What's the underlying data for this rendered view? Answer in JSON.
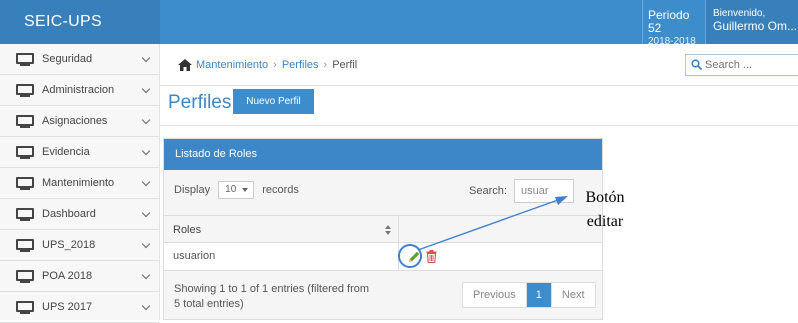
{
  "header": {
    "brand": "SEIC-UPS",
    "period_label": "Periodo 52",
    "period_range": "2018-2018",
    "welcome": "Bienvenido,",
    "user_name": "Guillermo Om..."
  },
  "sidebar": {
    "items": [
      {
        "label": "Seguridad",
        "icon": "monitor-icon"
      },
      {
        "label": "Administracion",
        "icon": "monitor-icon"
      },
      {
        "label": "Asignaciones",
        "icon": "monitor-icon"
      },
      {
        "label": "Evidencia",
        "icon": "monitor-icon"
      },
      {
        "label": "Mantenimiento",
        "icon": "monitor-icon"
      },
      {
        "label": "Dashboard",
        "icon": "monitor-icon"
      },
      {
        "label": "UPS_2018",
        "icon": "monitor-icon"
      },
      {
        "label": "POA 2018",
        "icon": "monitor-icon"
      },
      {
        "label": "UPS 2017",
        "icon": "monitor-icon"
      }
    ]
  },
  "breadcrumb": {
    "items": [
      "Mantenimiento",
      "Perfiles",
      "Perfil"
    ]
  },
  "search": {
    "placeholder": "Search ..."
  },
  "page": {
    "title": "Perfiles",
    "new_button": "Nuevo Perfil"
  },
  "panel": {
    "title": "Listado de Roles",
    "display_label": "Display",
    "display_value": "10",
    "records_label": "records",
    "search_label": "Search:",
    "search_value": "usuar",
    "columns": [
      "Roles",
      ""
    ],
    "rows": [
      {
        "role": "usuarion"
      }
    ],
    "info": "Showing 1 to 1 of 1 entries (filtered from 5 total entries)",
    "pager": {
      "previous": "Previous",
      "current": "1",
      "next": "Next"
    }
  },
  "annotation": {
    "line1": "Botón",
    "line2": "editar"
  },
  "colors": {
    "primary": "#3d8dcc",
    "edit_green": "#5aa02c",
    "delete_red": "#d9534f",
    "annotation_blue": "#3f7fd1"
  }
}
